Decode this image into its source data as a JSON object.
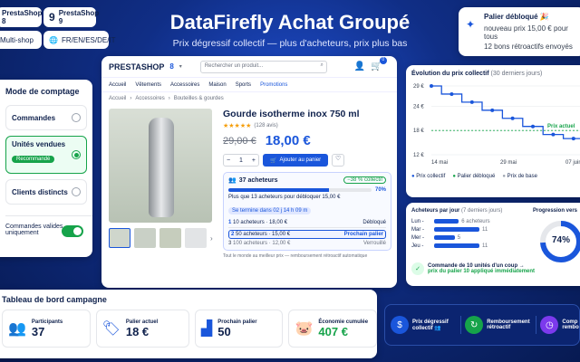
{
  "top_left": {
    "badge1": "PrestaShop 8",
    "badge2": "PrestaShop 9",
    "badge3": "Multi-shop",
    "badge4": "FR/EN/ES/DE/IT"
  },
  "header": {
    "title": "DataFirefly Achat Groupé",
    "subtitle": "Prix dégressif collectif — plus d'acheteurs, prix plus bas"
  },
  "toast": {
    "title": "Palier débloqué 🎉",
    "line1": "nouveau prix 15,00 € pour tous",
    "line2": "12 bons rétroactifs envoyés"
  },
  "counting": {
    "title": "Mode de comptage",
    "options": [
      "Commandes",
      "Unités vendues",
      "Clients distincts"
    ],
    "recommended": "Recommandé",
    "toggle_label_1": "Commandes valides",
    "toggle_label_2": "uniquement"
  },
  "shop": {
    "logo": "PRESTASHOP",
    "version": "8",
    "search_placeholder": "Rechercher un produit...",
    "cart_count": "0",
    "nav": [
      "Accueil",
      "Vêtements",
      "Accessoires",
      "Maison",
      "Sports",
      "Promotions"
    ],
    "breadcrumb": [
      "Accueil",
      "Accessoires",
      "Bouteilles & gourdes"
    ],
    "product_title": "Gourde isotherme inox 750 ml",
    "stars": "★★★★★",
    "reviews": "(128 avis)",
    "old_price": "29,00 €",
    "price": "18,00 €",
    "qty": "1",
    "add_to_cart": "Ajouter au panier",
    "buyers": "37 acheteurs",
    "discount": "−38 % collectif",
    "progress_pct": "70%",
    "progress": 0.7,
    "unlock_text": "Plus que 13 acheteurs pour débloquer 15,00 €",
    "ends": "Se termine dans 02 j 14 h 09 m",
    "tiers": [
      {
        "n": "1",
        "label": "10 acheteurs · 18,00 €",
        "state": "Débloqué"
      },
      {
        "n": "2",
        "label": "50 acheteurs · 15,00 €",
        "state": "Prochain palier"
      },
      {
        "n": "3",
        "label": "100 acheteurs · 12,00 €",
        "state": "Verrouillé"
      }
    ],
    "footnote": "Tout le monde au meilleur prix — remboursement rétroactif automatique"
  },
  "evolution": {
    "title": "Évolution du prix collectif",
    "range": "(30 derniers jours)",
    "price_actual": "Prix actuel",
    "legend": [
      "Prix collectif",
      "Palier débloqué",
      "Prix de base"
    ]
  },
  "chart_data": {
    "type": "line",
    "x": [
      "14 mai",
      "29 mai",
      "07 juin"
    ],
    "y_ticks": [
      "29 €",
      "24 €",
      "18 €",
      "12 €"
    ],
    "ylim": [
      12,
      29
    ],
    "series": [
      {
        "name": "Prix collectif",
        "values": [
          29,
          27,
          27,
          25,
          25,
          23,
          23,
          21,
          21,
          19,
          19,
          17,
          17,
          16,
          16,
          15
        ]
      }
    ],
    "reference": [
      {
        "name": "Prix actuel",
        "value": 18
      }
    ]
  },
  "buyers_day": {
    "title": "Acheteurs par jour",
    "range": "(7 derniers jours)",
    "rows": [
      {
        "d": "Lun",
        "v": 6,
        "label": "6 acheteurs"
      },
      {
        "d": "Mar",
        "v": 11,
        "label": "11"
      },
      {
        "d": "Mer",
        "v": 5,
        "label": "5"
      },
      {
        "d": "Jeu",
        "v": 11,
        "label": "11"
      }
    ],
    "progress_title": "Progression vers",
    "progress_value": "74%",
    "progress": 0.74,
    "note1": "Commande de 10 unités d'un coup →",
    "note2": "prix du palier 10 appliqué immédiatement"
  },
  "dashboard": {
    "title": "Tableau de bord campagne",
    "kpis": [
      {
        "label": "Participants",
        "value": "37"
      },
      {
        "label": "Palier actuel",
        "value": "18 €"
      },
      {
        "label": "Prochain palier",
        "value": "50"
      },
      {
        "label": "Économie cumulée",
        "value": "407 €"
      }
    ]
  },
  "features": [
    {
      "l1": "Prix dégressif",
      "l2": "collectif 👥"
    },
    {
      "l1": "Remboursement",
      "l2": "rétroactif"
    },
    {
      "l1": "Comp",
      "l2": "rembo"
    }
  ]
}
